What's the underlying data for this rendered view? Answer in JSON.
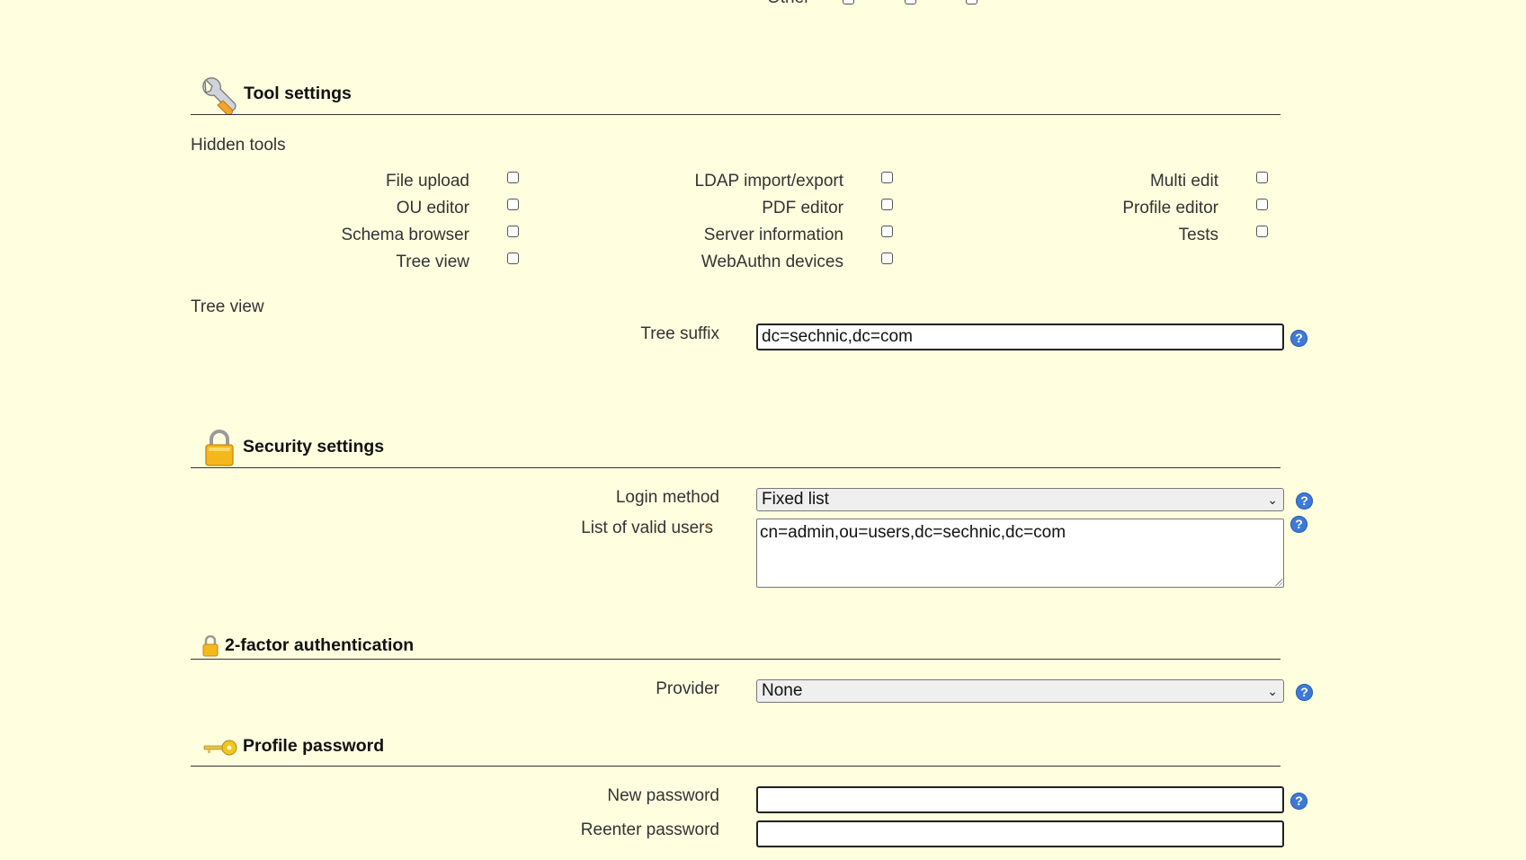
{
  "top": {
    "cut_label": "Other"
  },
  "tool_settings": {
    "title": "Tool settings",
    "hidden_tools_label": "Hidden tools",
    "tools": [
      {
        "label": "File upload",
        "checked": false
      },
      {
        "label": "OU editor",
        "checked": false
      },
      {
        "label": "Schema browser",
        "checked": false
      },
      {
        "label": "Tree view",
        "checked": false
      },
      {
        "label": "LDAP import/export",
        "checked": false
      },
      {
        "label": "PDF editor",
        "checked": false
      },
      {
        "label": "Server information",
        "checked": false
      },
      {
        "label": "WebAuthn devices",
        "checked": false
      },
      {
        "label": "Multi edit",
        "checked": false
      },
      {
        "label": "Profile editor",
        "checked": false
      },
      {
        "label": "Tests",
        "checked": false
      }
    ],
    "tree_view_label": "Tree view",
    "tree_suffix_label": "Tree suffix",
    "tree_suffix_value": "dc=sechnic,dc=com"
  },
  "security_settings": {
    "title": "Security settings",
    "login_method_label": "Login method",
    "login_method_value": "Fixed list",
    "valid_users_label": "List of valid users",
    "valid_users_required_mark": "*",
    "valid_users_value": "cn=admin,ou=users,dc=sechnic,dc=com"
  },
  "two_factor": {
    "title": "2-factor authentication",
    "provider_label": "Provider",
    "provider_value": "None"
  },
  "profile_password": {
    "title": "Profile password",
    "new_password_label": "New password",
    "new_password_value": "",
    "reenter_password_label": "Reenter password",
    "reenter_password_value": ""
  },
  "help_glyph": "?",
  "icons": [
    "wrench-icon",
    "lock-icon",
    "small-lock-icon",
    "key-icon",
    "help-icon",
    "chevron-down-icon"
  ],
  "colors": {
    "background": "#ffffe0",
    "help_icon": "#3d7ad8",
    "required_mark": "#e67e22"
  }
}
